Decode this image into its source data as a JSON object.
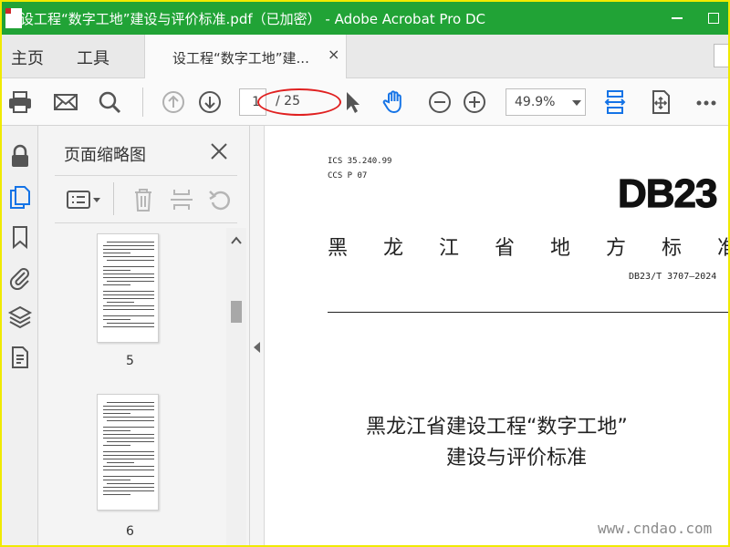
{
  "window": {
    "title": "设工程“数字工地”建设与评价标准.pdf（已加密） - Adobe Acrobat Pro DC",
    "titlebar_color": "#21a336"
  },
  "menu": {
    "home": "主页",
    "tools": "工具"
  },
  "doc_tab": {
    "label": "设工程“数字工地”建...",
    "close": "×"
  },
  "toolbar": {
    "page_current": "1",
    "page_total": "/ 25",
    "zoom": "49.9%",
    "icons": [
      "print-icon",
      "email-icon",
      "search-icon",
      "previous-page-icon",
      "next-page-icon",
      "select-cursor-icon",
      "hand-tool-icon",
      "zoom-out-icon",
      "zoom-in-icon",
      "fit-width-icon",
      "fit-page-icon",
      "more-icon"
    ]
  },
  "left_rail": {
    "icons": [
      "lock-icon",
      "page-thumbnails-icon",
      "bookmark-icon",
      "attachment-icon",
      "layers-icon",
      "document-icon"
    ],
    "active_color": "#1473e6"
  },
  "thumb_panel": {
    "title": "页面缩略图",
    "close": "×",
    "tools": [
      "thumbnail-options-icon",
      "delete-page-icon",
      "insert-page-icon",
      "rotate-page-icon"
    ],
    "pages": [
      {
        "label": "5"
      },
      {
        "label": "6"
      }
    ]
  },
  "document": {
    "ics": "ICS 35.240.99",
    "ccs": "CCS P 07",
    "db_code": "DB23",
    "province_line": "黑龙江省地方标准",
    "standard_number": "DB23/T 3707—2024",
    "title_line1": "黑龙江省建设工程“数字工地”",
    "title_line2": "建设与评价标准"
  },
  "watermark": "www.cndao.com",
  "annotation": {
    "color": "#e02020"
  }
}
